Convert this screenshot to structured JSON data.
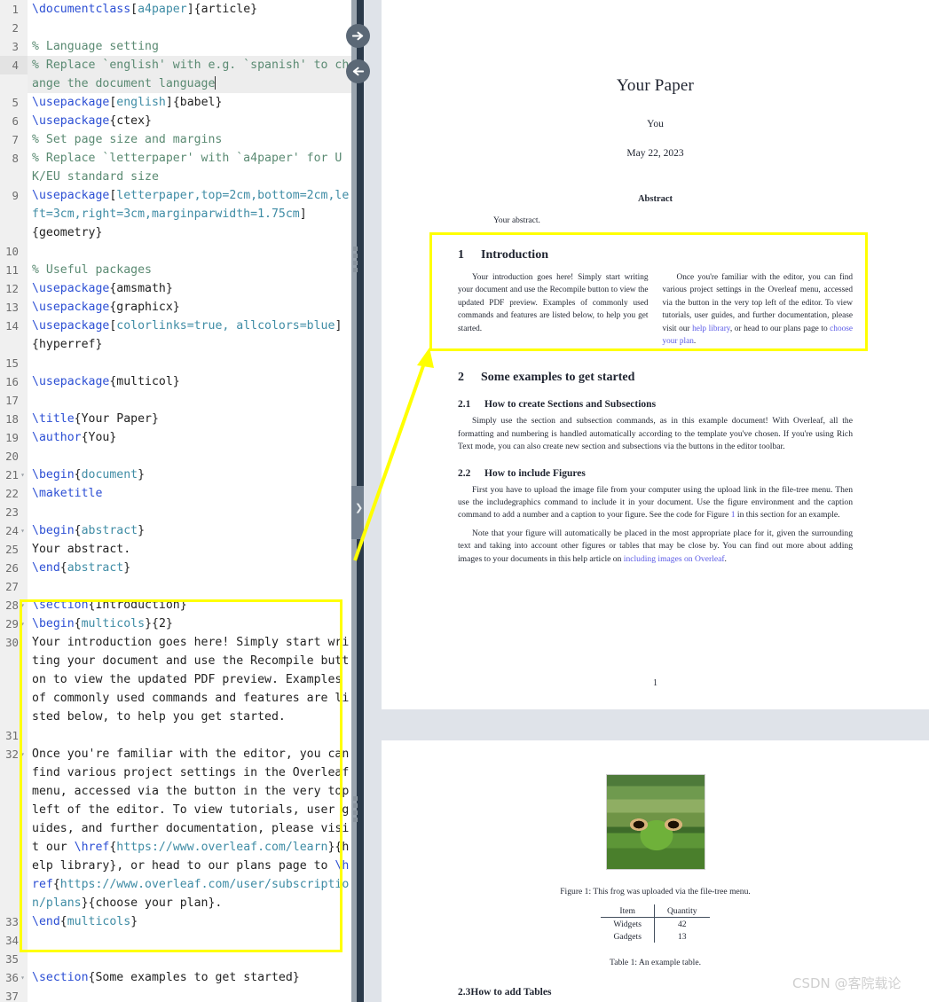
{
  "editor": {
    "language": "latex",
    "active_line": 4,
    "lines": [
      {
        "n": "1",
        "fold": false,
        "segs": [
          {
            "t": "\\documentclass",
            "c": "kw"
          },
          {
            "t": "[",
            "c": "pl"
          },
          {
            "t": "a4paper",
            "c": "opt"
          },
          {
            "t": "]{article}",
            "c": "pl"
          }
        ]
      },
      {
        "n": "2",
        "fold": false,
        "segs": []
      },
      {
        "n": "3",
        "fold": false,
        "segs": [
          {
            "t": "% Language setting",
            "c": "cm"
          }
        ]
      },
      {
        "n": "4",
        "fold": false,
        "active": true,
        "cursor": true,
        "segs": [
          {
            "t": "% Replace `english' with e.g. `spanish' to change the document language",
            "c": "cm"
          }
        ]
      },
      {
        "n": "5",
        "fold": false,
        "segs": [
          {
            "t": "\\usepackage",
            "c": "kw"
          },
          {
            "t": "[",
            "c": "pl"
          },
          {
            "t": "english",
            "c": "opt"
          },
          {
            "t": "]{babel}",
            "c": "pl"
          }
        ]
      },
      {
        "n": "6",
        "fold": false,
        "segs": [
          {
            "t": "\\usepackage",
            "c": "kw"
          },
          {
            "t": "{ctex}",
            "c": "pl"
          }
        ]
      },
      {
        "n": "7",
        "fold": false,
        "segs": [
          {
            "t": "% Set page size and margins",
            "c": "cm"
          }
        ]
      },
      {
        "n": "8",
        "fold": false,
        "segs": [
          {
            "t": "% Replace `letterpaper' with `a4paper' for UK/EU standard size",
            "c": "cm"
          }
        ]
      },
      {
        "n": "9",
        "fold": false,
        "segs": [
          {
            "t": "\\usepackage",
            "c": "kw"
          },
          {
            "t": "[",
            "c": "pl"
          },
          {
            "t": "letterpaper,top=2cm,bottom=2cm,left=3cm,right=3cm,marginparwidth=1.75cm",
            "c": "opt"
          },
          {
            "t": "]",
            "c": "pl"
          },
          {
            "t": "\n{geometry}",
            "c": "pl"
          }
        ]
      },
      {
        "n": "10",
        "fold": false,
        "segs": []
      },
      {
        "n": "11",
        "fold": false,
        "segs": [
          {
            "t": "% Useful packages",
            "c": "cm"
          }
        ]
      },
      {
        "n": "12",
        "fold": false,
        "segs": [
          {
            "t": "\\usepackage",
            "c": "kw"
          },
          {
            "t": "{amsmath}",
            "c": "pl"
          }
        ]
      },
      {
        "n": "13",
        "fold": false,
        "segs": [
          {
            "t": "\\usepackage",
            "c": "kw"
          },
          {
            "t": "{graphicx}",
            "c": "pl"
          }
        ]
      },
      {
        "n": "14",
        "fold": false,
        "segs": [
          {
            "t": "\\usepackage",
            "c": "kw"
          },
          {
            "t": "[",
            "c": "pl"
          },
          {
            "t": "colorlinks=true, allcolors=blue",
            "c": "opt"
          },
          {
            "t": "]",
            "c": "pl"
          },
          {
            "t": "\n{hyperref}",
            "c": "pl"
          }
        ]
      },
      {
        "n": "15",
        "fold": false,
        "segs": []
      },
      {
        "n": "16",
        "fold": false,
        "segs": [
          {
            "t": "\\usepackage",
            "c": "kw"
          },
          {
            "t": "{multicol}",
            "c": "pl"
          }
        ]
      },
      {
        "n": "17",
        "fold": false,
        "segs": []
      },
      {
        "n": "18",
        "fold": false,
        "segs": [
          {
            "t": "\\title",
            "c": "kw"
          },
          {
            "t": "{Your Paper}",
            "c": "pl"
          }
        ]
      },
      {
        "n": "19",
        "fold": false,
        "segs": [
          {
            "t": "\\author",
            "c": "kw"
          },
          {
            "t": "{You}",
            "c": "pl"
          }
        ]
      },
      {
        "n": "20",
        "fold": false,
        "segs": []
      },
      {
        "n": "21",
        "fold": true,
        "segs": [
          {
            "t": "\\begin",
            "c": "kw"
          },
          {
            "t": "{",
            "c": "pl"
          },
          {
            "t": "document",
            "c": "opt"
          },
          {
            "t": "}",
            "c": "pl"
          }
        ]
      },
      {
        "n": "22",
        "fold": false,
        "segs": [
          {
            "t": "\\maketitle",
            "c": "kw"
          }
        ]
      },
      {
        "n": "23",
        "fold": false,
        "segs": []
      },
      {
        "n": "24",
        "fold": true,
        "segs": [
          {
            "t": "\\begin",
            "c": "kw"
          },
          {
            "t": "{",
            "c": "pl"
          },
          {
            "t": "abstract",
            "c": "opt"
          },
          {
            "t": "}",
            "c": "pl"
          }
        ]
      },
      {
        "n": "25",
        "fold": false,
        "segs": [
          {
            "t": "Your abstract.",
            "c": "pl"
          }
        ]
      },
      {
        "n": "26",
        "fold": false,
        "segs": [
          {
            "t": "\\end",
            "c": "kw"
          },
          {
            "t": "{",
            "c": "pl"
          },
          {
            "t": "abstract",
            "c": "opt"
          },
          {
            "t": "}",
            "c": "pl"
          }
        ]
      },
      {
        "n": "27",
        "fold": false,
        "segs": []
      },
      {
        "n": "28",
        "fold": true,
        "segs": [
          {
            "t": "\\section",
            "c": "kw"
          },
          {
            "t": "{Introduction}",
            "c": "pl"
          }
        ]
      },
      {
        "n": "29",
        "fold": true,
        "segs": [
          {
            "t": "\\begin",
            "c": "kw"
          },
          {
            "t": "{",
            "c": "pl"
          },
          {
            "t": "multicols",
            "c": "opt"
          },
          {
            "t": "}{2}",
            "c": "pl"
          }
        ]
      },
      {
        "n": "30",
        "fold": false,
        "segs": [
          {
            "t": "Your introduction goes here! Simply start writing your document and use the Recompile button to view the updated PDF preview. Examples of commonly used commands and features are listed below, to help you get started.",
            "c": "pl"
          }
        ]
      },
      {
        "n": "31",
        "fold": false,
        "segs": []
      },
      {
        "n": "32",
        "fold": true,
        "segs": [
          {
            "t": "Once you're familiar with the editor, you can find various project settings in the Overleaf menu, accessed via the button in the very top left of the editor. To view tutorials, user guides, and further documentation, please visit our ",
            "c": "pl"
          },
          {
            "t": "\\href",
            "c": "kw"
          },
          {
            "t": "{",
            "c": "pl"
          },
          {
            "t": "https://www.overleaf.com/learn",
            "c": "opt"
          },
          {
            "t": "}{help library}, or head to our plans page to ",
            "c": "pl"
          },
          {
            "t": "\\href",
            "c": "kw"
          },
          {
            "t": "{",
            "c": "pl"
          },
          {
            "t": "https://www.overleaf.com/user/subscription/plans",
            "c": "opt"
          },
          {
            "t": "}{choose your plan}.",
            "c": "pl"
          }
        ]
      },
      {
        "n": "33",
        "fold": false,
        "segs": [
          {
            "t": "\\end",
            "c": "kw"
          },
          {
            "t": "{",
            "c": "pl"
          },
          {
            "t": "multicols",
            "c": "opt"
          },
          {
            "t": "}",
            "c": "pl"
          }
        ]
      },
      {
        "n": "34",
        "fold": false,
        "segs": []
      },
      {
        "n": "35",
        "fold": false,
        "segs": []
      },
      {
        "n": "36",
        "fold": true,
        "segs": [
          {
            "t": "\\section",
            "c": "kw"
          },
          {
            "t": "{Some examples to get started}",
            "c": "pl"
          }
        ]
      },
      {
        "n": "37",
        "fold": false,
        "segs": []
      }
    ]
  },
  "divider": {
    "forward_icon": "arrow-right-icon",
    "back_icon": "arrow-left-icon",
    "handle_icon": "chevron-right-icon"
  },
  "pdf": {
    "page1": {
      "title": "Your Paper",
      "author": "You",
      "date": "May 22, 2023",
      "abstract_heading": "Abstract",
      "abstract_body": "Your abstract.",
      "section1_num": "1",
      "section1_title": "Introduction",
      "intro_col1": "Your introduction goes here! Simply start writing your document and use the Recompile button to view the updated PDF preview. Examples of commonly used commands and features are listed below, to help you get started.",
      "intro_col1b": "Once you're familiar with the editor, you",
      "intro_col2_a": "can find various project settings in the Overleaf menu, accessed via the button in the very top left of the editor. To view tutorials, user guides, and further documentation, please visit our ",
      "intro_link1": "help library",
      "intro_col2_b": ", or head to our plans page to ",
      "intro_link2": "choose your plan",
      "intro_col2_c": ".",
      "section2_num": "2",
      "section2_title": "Some examples to get started",
      "sub21_num": "2.1",
      "sub21_title": "How to create Sections and Subsections",
      "sub21_body": "Simply use the section and subsection commands, as in this example document! With Overleaf, all the formatting and numbering is handled automatically according to the template you've chosen. If you're using Rich Text mode, you can also create new section and subsections via the buttons in the editor toolbar.",
      "sub22_num": "2.2",
      "sub22_title": "How to include Figures",
      "sub22_p1_a": "First you have to upload the image file from your computer using the upload link in the file-tree menu. Then use the includegraphics command to include it in your document. Use the figure environment and the caption command to add a number and a caption to your figure. See the code for Figure ",
      "sub22_p1_ref": "1",
      "sub22_p1_b": " in this section for an example.",
      "sub22_p2_a": "Note that your figure will automatically be placed in the most appropriate place for it, given the surrounding text and taking into account other figures or tables that may be close by. You can find out more about adding images to your documents in this help article on ",
      "sub22_p2_link": "including images on Overleaf",
      "sub22_p2_b": ".",
      "page_number": "1"
    },
    "page2": {
      "figure_alt": "frog-photo",
      "figure_caption": "Figure 1: This frog was uploaded via the file-tree menu.",
      "table": {
        "headers": [
          "Item",
          "Quantity"
        ],
        "rows": [
          [
            "Widgets",
            "42"
          ],
          [
            "Gadgets",
            "13"
          ]
        ]
      },
      "table_caption": "Table 1: An example table.",
      "sub23_num": "2.3",
      "sub23_title": "How to add Tables"
    }
  },
  "annotations": {
    "highlight_color": "#ffff00",
    "arrow_from": "code-highlight-box",
    "arrow_to": "pdf-highlight-box"
  },
  "watermark": "CSDN @客院载论"
}
